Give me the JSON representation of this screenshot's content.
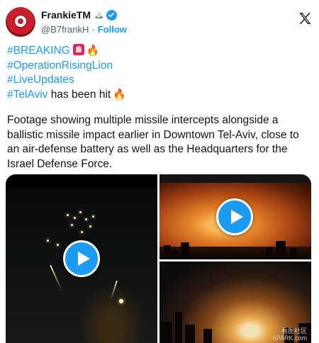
{
  "tweet": {
    "display_name": "FrankieTM",
    "display_name_emoji": "🏔️",
    "handle": "@B7frankH",
    "separator": "·",
    "follow_label": "Follow",
    "hashtags": {
      "breaking": "#BREAKING",
      "operation": "#OperationRisingLion",
      "live": "#LiveUpdates",
      "telaviv": "#TelAviv"
    },
    "telaviv_suffix": " has been hit",
    "paragraph_lines": [
      "Footage showing multiple missile intercepts alongside a",
      "ballistic missile impact earlier in Downtown Tel-Aviv, close to",
      "an air-defense battery as well as the Headquarters for the",
      "Israel Defense Force."
    ],
    "watermark_line1": "看图社区",
    "watermark_line2": "6PARK.com"
  },
  "icons": {
    "verified": "verified-badge-icon",
    "x_logo": "x-logo-icon",
    "siren": "siren-emoji-icon",
    "fire": "fire-emoji-icon",
    "play": "play-icon"
  },
  "colors": {
    "accent": "#1d9bf0",
    "text": "#0f1419",
    "muted": "#536471"
  }
}
